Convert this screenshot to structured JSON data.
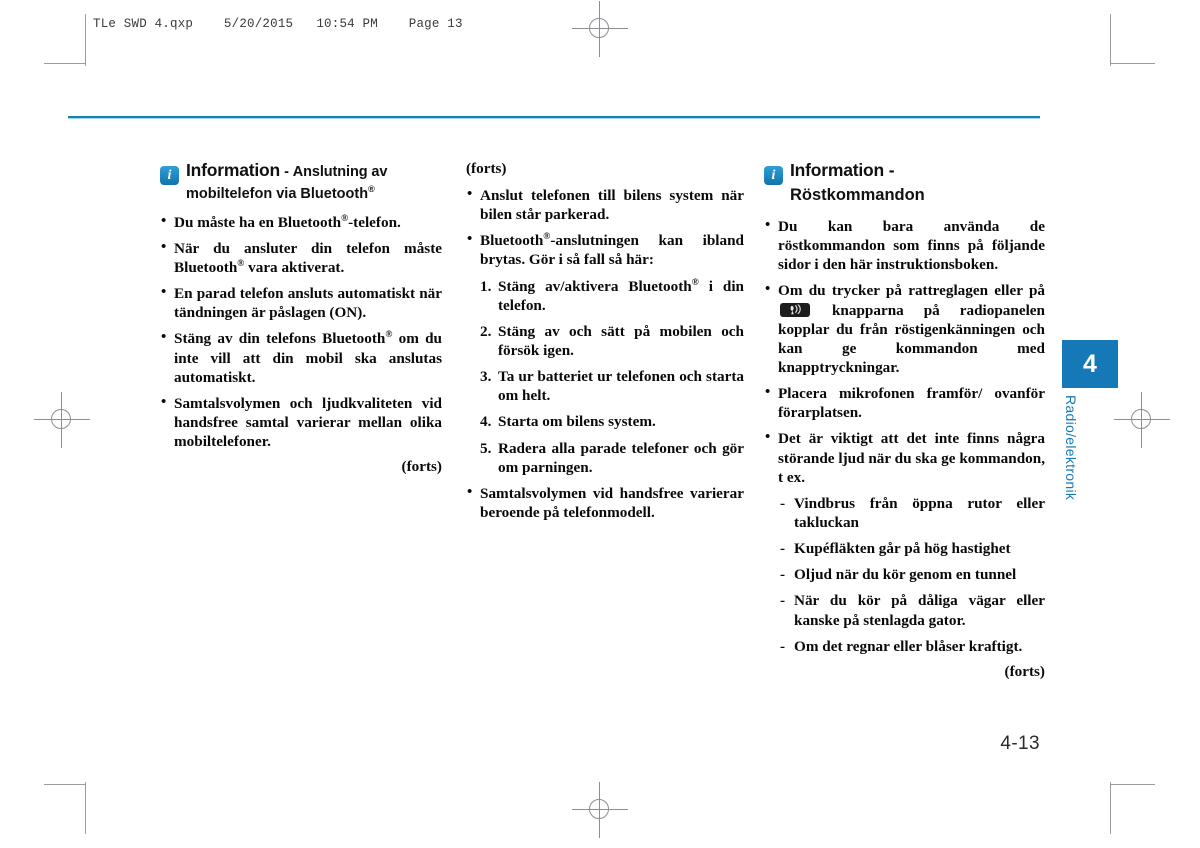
{
  "page": {
    "slug": "TLe SWD 4.qxp    5/20/2015   10:54 PM    Page 13",
    "folio": "4-13",
    "accent_color": "#1579b8",
    "rule_color": "#1a7fb5"
  },
  "chapter_tab": {
    "number": "4",
    "label": "Radio/elektronik"
  },
  "left_column": {
    "info_icon_name": "information-icon",
    "heading_main": "Information",
    "heading_dash": "-",
    "heading_part1": "Anslutning av",
    "heading_part2": "mobiltelefon via Bluetooth",
    "heading_reg": "®",
    "bullets": [
      {
        "pre": "Du måste ha en Bluetooth",
        "reg": "®",
        "post": "-telefon."
      },
      {
        "pre": "När du ansluter din telefon måste Bluetooth",
        "reg": "®",
        "post": " vara aktiverat."
      },
      {
        "pre": "En parad telefon ansluts automatiskt när tändningen är påslagen (ON).",
        "reg": "",
        "post": ""
      },
      {
        "pre": "Stäng av din telefons Bluetooth",
        "reg": "®",
        "post": " om du inte vill att din mobil ska anslutas automatiskt."
      },
      {
        "pre": "Samtalsvolymen och ljudkvaliteten vid handsfree samtal varierar mellan olika mobiltelefoner.",
        "reg": "",
        "post": ""
      }
    ],
    "continued": "(forts)"
  },
  "middle_column": {
    "continued_lead": "(forts)",
    "bullet_1": "Anslut telefonen till bilens system när bilen står parkerad.",
    "bullet_2": {
      "pre": "Bluetooth",
      "reg": "®",
      "post": "-anslutningen kan ibland brytas. Gör i så fall så här:"
    },
    "numbered": [
      {
        "num": "1.",
        "pre": "Stäng av/aktivera Bluetooth",
        "reg": "®",
        "post": " i din telefon."
      },
      {
        "num": "2.",
        "pre": "Stäng av och sätt på mobilen och försök igen.",
        "reg": "",
        "post": ""
      },
      {
        "num": "3.",
        "pre": "Ta ur batteriet ur telefonen och starta om helt.",
        "reg": "",
        "post": ""
      },
      {
        "num": "4.",
        "pre": "Starta om bilens system.",
        "reg": "",
        "post": ""
      },
      {
        "num": "5.",
        "pre": "Radera alla parade telefoner och gör om parningen.",
        "reg": "",
        "post": ""
      }
    ],
    "bullet_3": "Samtalsvolymen vid handsfree varierar beroende på telefonmodell."
  },
  "right_column": {
    "info_icon_name": "information-icon",
    "heading_main": "Information -",
    "heading_sub": "Röstkommandon",
    "bullet_1": "Du kan bara använda de röstkommandon som finns på följande sidor i den här instruktionsboken.",
    "bullet_2": {
      "pre": "Om du trycker på rattreglagen eller på ",
      "key_icon_name": "voice-recognition-key-icon",
      "post": " knapparna på radiopanelen kopplar du från röstigenkänningen och kan ge kommandon med knapptryckningar."
    },
    "bullet_3": "Placera mikrofonen framför/ ovanför förarplatsen.",
    "bullet_4": "Det är viktigt att det inte finns några störande ljud när du ska ge kommandon, t ex.",
    "dashes": [
      "Vindbrus från öppna rutor eller takluckan",
      "Kupéfläkten går på hög hastighet",
      "Oljud när du kör genom en tunnel",
      "När du kör på dåliga vägar eller kanske på stenlagda gator.",
      "Om det regnar eller blåser kraftigt."
    ],
    "continued": "(forts)"
  }
}
